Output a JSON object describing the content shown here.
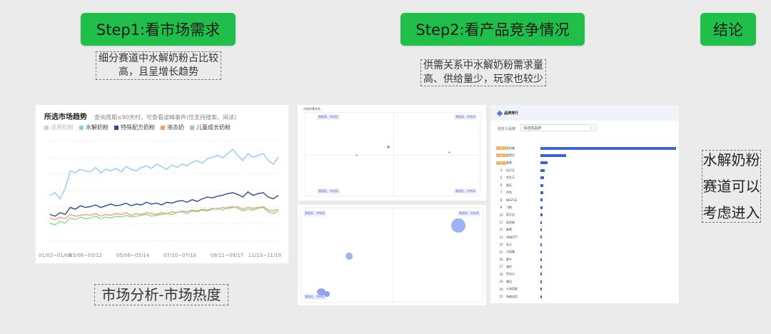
{
  "steps": {
    "step1": "Step1:看市场需求",
    "step2": "Step2:看产品竞争情况",
    "conclusion_btn": "结论"
  },
  "notes": {
    "note1_line1": "细分赛道中水解奶粉占比较",
    "note1_line2": "高，且呈增长趋势",
    "note2_line1": "供需关系中水解奶粉需求量",
    "note2_line2": "高、供给量少，玩家也较少",
    "caption1": "市场分析-市场热度",
    "conclusion_line1": "水解奶粉",
    "conclusion_line2": "赛道可以",
    "conclusion_line3": "考虑进入"
  },
  "trend_panel": {
    "title": "所选市场趋势",
    "subtitle": "查询周期≤90天时，可查看波峰事件(仅支持搜索、阅读)",
    "legend": [
      {
        "name": "适用奶粉",
        "color": "#cfcfcf"
      },
      {
        "name": "水解奶粉",
        "color": "#8ccdf0"
      },
      {
        "name": "特殊配方奶粉",
        "color": "#2a4a9a"
      },
      {
        "name": "液态奶",
        "color": "#f0a070"
      },
      {
        "name": "儿童成长奶粉",
        "color": "#8fd69a"
      }
    ]
  },
  "chart_data": {
    "type": "line",
    "title": "所选市场趋势",
    "x": [
      "01/02~01/08",
      "03/06~03/12",
      "05/06~05/14",
      "07/10~07/16",
      "09/11~09/17",
      "11/13~11/19"
    ],
    "series": [
      {
        "name": "水解奶粉",
        "color": "#8ccdf0",
        "values": [
          52,
          55,
          48,
          60,
          80,
          78,
          82,
          80,
          79,
          84,
          78,
          82,
          80,
          83,
          79,
          85,
          82,
          80,
          84,
          86,
          83,
          88,
          85,
          82,
          87,
          84,
          88,
          86,
          90,
          92,
          89,
          94,
          96,
          98,
          95,
          100,
          105,
          98,
          92,
          100,
          96,
          98,
          100,
          92,
          88,
          96
        ]
      },
      {
        "name": "特殊配方奶粉",
        "color": "#2a4a9a",
        "values": [
          30,
          28,
          32,
          30,
          38,
          36,
          40,
          38,
          39,
          41,
          38,
          40,
          42,
          40,
          41,
          43,
          40,
          42,
          41,
          44,
          42,
          43,
          41,
          44,
          43,
          45,
          46,
          44,
          47,
          45,
          48,
          50,
          49,
          51,
          52,
          54,
          55,
          53,
          50,
          56,
          52,
          54,
          55,
          50,
          48,
          52
        ]
      },
      {
        "name": "液态奶",
        "color": "#f0a070",
        "values": [
          26,
          24,
          27,
          25,
          30,
          28,
          29,
          30,
          29,
          31,
          28,
          30,
          29,
          31,
          30,
          32,
          29,
          31,
          30,
          32,
          31,
          30,
          32,
          31,
          33,
          32,
          34,
          33,
          35,
          34,
          36,
          35,
          37,
          36,
          38,
          37,
          38,
          39,
          36,
          38,
          37,
          38,
          39,
          35,
          34,
          36
        ]
      },
      {
        "name": "儿童成长奶粉",
        "color": "#8fd69a",
        "values": [
          20,
          18,
          22,
          20,
          26,
          24,
          27,
          25,
          26,
          28,
          25,
          27,
          26,
          28,
          27,
          29,
          27,
          28,
          29,
          30,
          28,
          29,
          30,
          31,
          30,
          32,
          33,
          31,
          34,
          33,
          35,
          34,
          36,
          37,
          35,
          38,
          39,
          37,
          34,
          36,
          35,
          37,
          38,
          33,
          31,
          34
        ]
      }
    ],
    "ylim": [
      0,
      115
    ]
  },
  "quadrant": {
    "title": "市场供需关系",
    "labels": [
      "需量高、供给低",
      "需量高、供给高",
      "需量低、供给低",
      "需量低、供给高"
    ]
  },
  "brand_panel": {
    "title": "品牌排行",
    "filter_label": "自定义品牌",
    "filter_placeholder": "请选择品牌",
    "brands": [
      {
        "rank": "1",
        "name": "爱他美",
        "value": 100
      },
      {
        "rank": "2",
        "name": "美赞臣",
        "value": 19
      },
      {
        "rank": "3",
        "name": "雀巢",
        "value": 5
      },
      {
        "rank": "4",
        "name": "佳贝艾",
        "value": 3
      },
      {
        "rank": "5",
        "name": "合生元",
        "value": 2.5
      },
      {
        "rank": "6",
        "name": "惠氏",
        "value": 2
      },
      {
        "rank": "7",
        "name": "伊利",
        "value": 2
      },
      {
        "rank": "8",
        "name": "NESTLE",
        "value": 1.6
      },
      {
        "rank": "9",
        "name": "飞鹤",
        "value": 1.5
      },
      {
        "rank": "10",
        "name": "君乐宝",
        "value": 1.4
      },
      {
        "rank": "11",
        "name": "诺优能",
        "value": 1.2
      },
      {
        "rank": "12",
        "name": "美素",
        "value": 1
      },
      {
        "rank": "13",
        "name": "ABBOTT",
        "value": 0.8
      },
      {
        "rank": "14",
        "name": "圣元",
        "value": 0.5
      },
      {
        "rank": "15",
        "name": "贝因美",
        "value": 0.4
      },
      {
        "rank": "16",
        "name": "蒙牛",
        "value": 0.3
      },
      {
        "rank": "17",
        "name": "澳优",
        "value": 0.3
      },
      {
        "rank": "18",
        "name": "完达山",
        "value": 0.2
      },
      {
        "rank": "19",
        "name": "雅培",
        "value": 0.2
      },
      {
        "rank": "20",
        "name": "卡洛塔妮",
        "value": 0.2
      },
      {
        "rank": "21",
        "name": "海普诺凯",
        "value": 0.1
      }
    ]
  }
}
